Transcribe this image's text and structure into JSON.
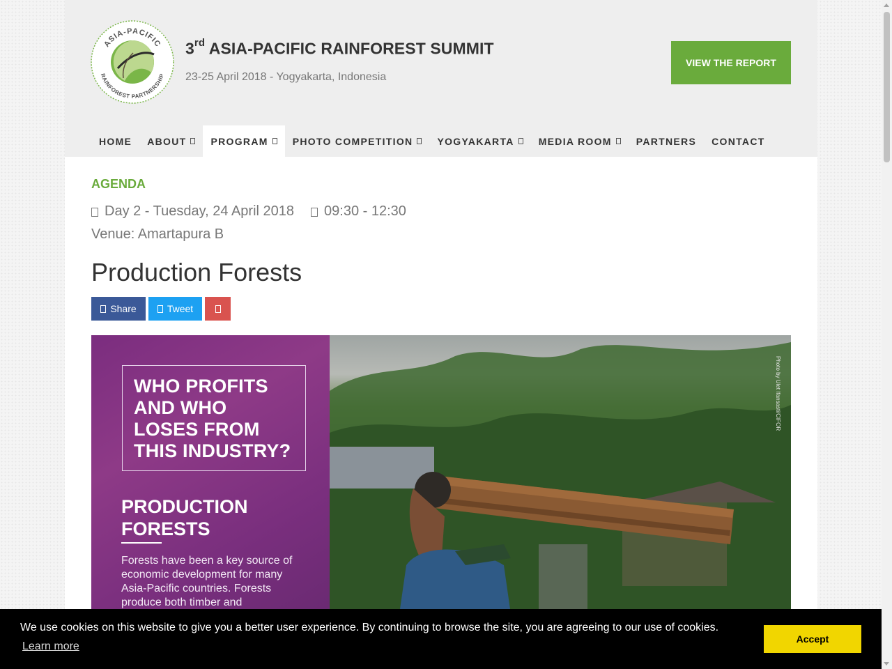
{
  "header": {
    "title_prefix": "3",
    "title_ordinal": "rd",
    "title_main": "ASIA-PACIFIC RAINFOREST SUMMIT",
    "dates": "23-25 April 2018 - Yogyakarta, Indonesia",
    "report_button": "VIEW THE REPORT",
    "logo_text_top": "ASIA-PACIFIC",
    "logo_text_bottom": "RAINFOREST PARTNERSHIP"
  },
  "nav": {
    "items": [
      {
        "label": "HOME"
      },
      {
        "label": "ABOUT"
      },
      {
        "label": "PROGRAM"
      },
      {
        "label": "PHOTO COMPETITION"
      },
      {
        "label": "YOGYAKARTA"
      },
      {
        "label": "MEDIA ROOM"
      },
      {
        "label": "PARTNERS"
      },
      {
        "label": "CONTACT"
      }
    ],
    "active": "PROGRAM"
  },
  "agenda": {
    "section_label": "AGENDA",
    "day": "Day 2 - Tuesday, 24 April 2018",
    "time": "09:30 - 12:30",
    "venue": "Venue: Amartapura B",
    "title": "Production Forests"
  },
  "share": {
    "facebook_label": "Share",
    "twitter_label": "Tweet"
  },
  "hero": {
    "question": "WHO PROFITS AND WHO LOSES FROM THIS INDUSTRY?",
    "heading": "PRODUCTION FORESTS",
    "body": "Forests have been a key source of economic development for many Asia-Pacific countries. Forests produce both timber and",
    "photo_credit": "Photo by Ulet Ifansasti/CIFOR"
  },
  "cookie": {
    "message": "We use cookies on this website to give you a better user experience. By continuing to browse the site, you are agreeing to our use of cookies.",
    "learn_more": "Learn more",
    "accept": "Accept"
  },
  "colors": {
    "brand_green": "#6aab3c",
    "facebook": "#3b5998",
    "twitter": "#1da1f2",
    "pinterest": "#d9534f",
    "accept_yellow": "#f1d600"
  }
}
